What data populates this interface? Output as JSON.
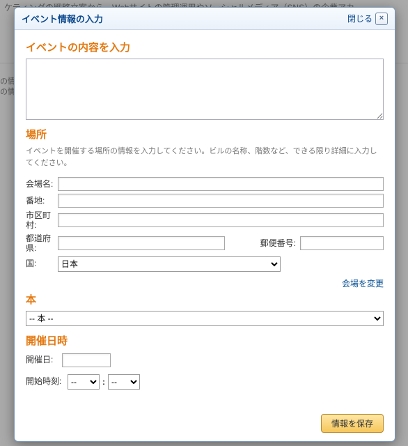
{
  "background": {
    "line": "ケティングの戦略立案から、Webサイトの管理運用やソーシャルメディア（SNS）の企業アカ",
    "side1": "の情",
    "side2": "の情"
  },
  "modal": {
    "title": "イベント情報の入力",
    "close_label": "閉じる"
  },
  "content": {
    "heading": "イベントの内容を入力",
    "value": ""
  },
  "location": {
    "heading": "場所",
    "subtext": "イベントを開催する場所の情報を入力してください。ビルの名称、階数など、できる限り詳細に入力してください。",
    "labels": {
      "venue": "会場名:",
      "street": "番地:",
      "city": "市区町村:",
      "prefecture": "都道府県:",
      "postal": "郵便番号:",
      "country": "国:"
    },
    "values": {
      "venue": "",
      "street": "",
      "city": "",
      "prefecture": "",
      "postal": "",
      "country": "日本"
    },
    "change_venue_link": "会場を変更"
  },
  "book": {
    "heading": "本",
    "selected": "-- 本 --"
  },
  "datetime": {
    "heading": "開催日時",
    "date_label": "開催日:",
    "date_value": "",
    "time_label": "開始時刻:",
    "hour": "--",
    "minute": "--",
    "separator": ":"
  },
  "footer": {
    "save_label": "情報を保存"
  }
}
